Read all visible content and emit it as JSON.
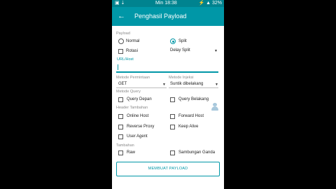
{
  "status_bar": {
    "time": "Min 18:38",
    "battery": "32%",
    "left_icons": "▣ ⇣",
    "right_icons": "⚡ ▲"
  },
  "app_bar": {
    "back_icon": "arrow-left",
    "title": "Penghasil Payload"
  },
  "payload": {
    "section_label": "Payload",
    "normal_label": "Normal",
    "split_label": "Split",
    "split_selected": true,
    "rotasi_label": "Rotasi",
    "split_type_value": "Delay Split",
    "url_host_label": "URL/Host",
    "url_host_value": ""
  },
  "request_method": {
    "label": "Metode Permintaan",
    "value": "GET"
  },
  "injection_method": {
    "label": "Metode Injeksi",
    "value": "Suntik dibelakang"
  },
  "query_method": {
    "label": "Metode Query",
    "query_front": "Query Depan",
    "query_back": "Query Belakang"
  },
  "extra_header": {
    "label": "Header Tambahan",
    "online_host": "Online Host",
    "forward_host": "Forward Host",
    "reverse_proxy": "Reverse Proxy",
    "keep_alive": "Keep Alive",
    "user_agent": "User Agent"
  },
  "addition": {
    "label": "Tambahan",
    "raw": "Raw",
    "double_connection": "Sambungan Ganda"
  },
  "actions": {
    "generate_button": "MEMBUAT PAYLOAD"
  },
  "colors": {
    "primary": "#0097a7",
    "primary_dark": "#00838f"
  }
}
